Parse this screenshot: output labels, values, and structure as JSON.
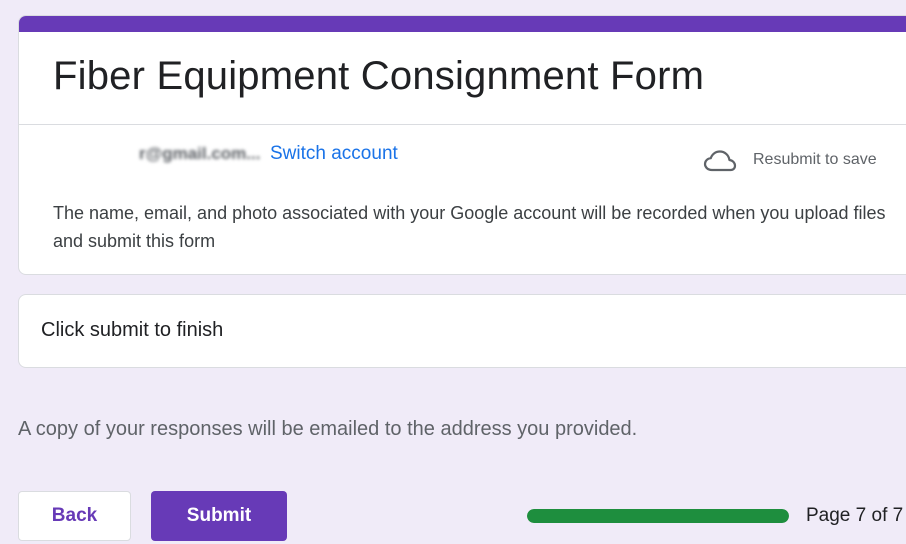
{
  "form": {
    "title": "Fiber Equipment Consignment Form",
    "account_email": "r@gmail.com...",
    "switch_account": "Switch account",
    "save_status": "Resubmit to save",
    "notice": "The name, email, and photo associated with your Google account will be recorded when you upload files and submit this form"
  },
  "finish": {
    "text": "Click submit to finish"
  },
  "confirmation": {
    "copy_note": "A copy of your responses will be emailed to the address you provided."
  },
  "footer": {
    "back_label": "Back",
    "submit_label": "Submit",
    "progress_fraction": 1.0,
    "page_indicator": "Page 7 of 7"
  },
  "icons": {
    "save_status_icon": "cloud-icon"
  },
  "colors": {
    "accent": "#673ab7",
    "background": "#f0ebf8",
    "link": "#1a73e8",
    "progress": "#1e8e3e"
  }
}
